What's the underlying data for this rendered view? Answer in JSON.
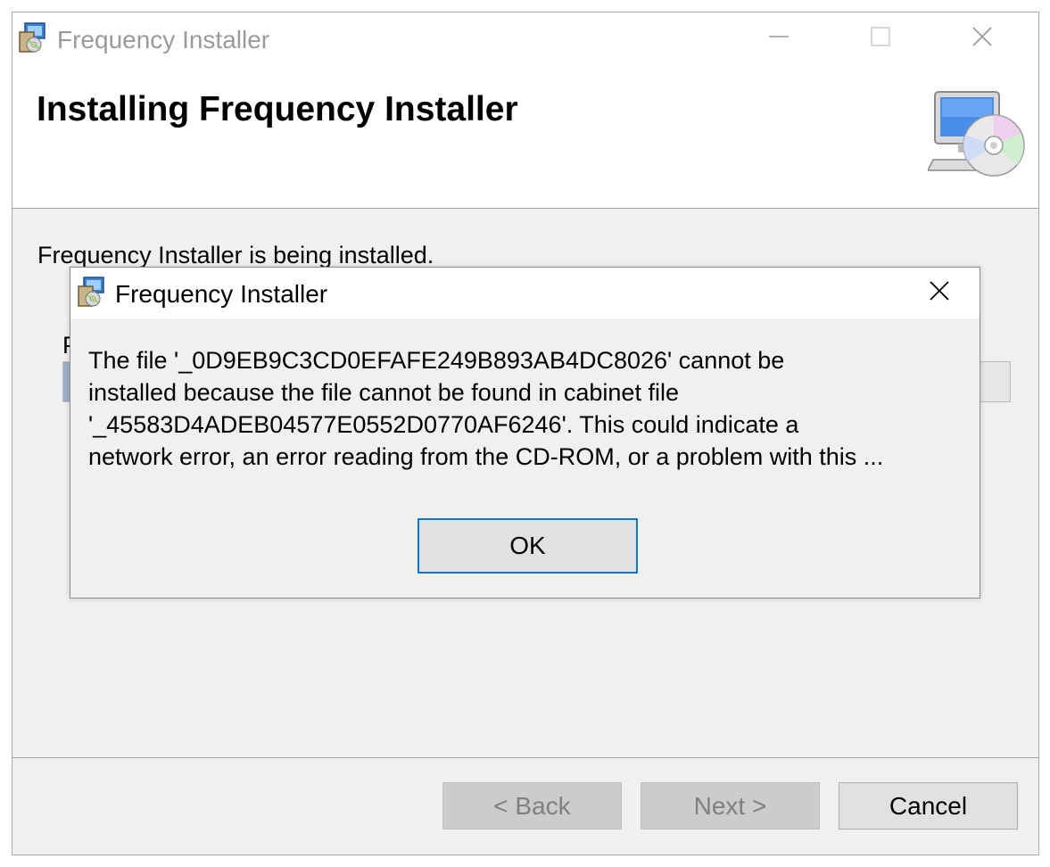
{
  "window": {
    "title": "Frequency Installer",
    "icons": {
      "app": "installer-package-icon",
      "minimize": "minimize-icon",
      "maximize": "maximize-icon",
      "close": "close-icon"
    }
  },
  "header": {
    "title": "Installing Frequency Installer",
    "graphic": "computer-cd-icon"
  },
  "body": {
    "status": "Frequency Installer is being installed.",
    "obscured_label_fragment": "P",
    "progress_fraction": 0.012
  },
  "footer": {
    "back_label": "< Back",
    "next_label": "Next >",
    "cancel_label": "Cancel"
  },
  "dialog": {
    "title": "Frequency Installer",
    "message": "The file '_0D9EB9C3CD0EFAFE249B893AB4DC8026' cannot be\ninstalled because the file cannot be found in cabinet file\n'_45583D4ADEB04577E0552D0770AF6246'. This could indicate a\nnetwork error, an error reading from the CD-ROM, or a problem with this ...",
    "ok_label": "OK"
  },
  "colors": {
    "accent": "#0078d7",
    "progress": "#9bb0c9",
    "face": "#f0f0f0"
  }
}
